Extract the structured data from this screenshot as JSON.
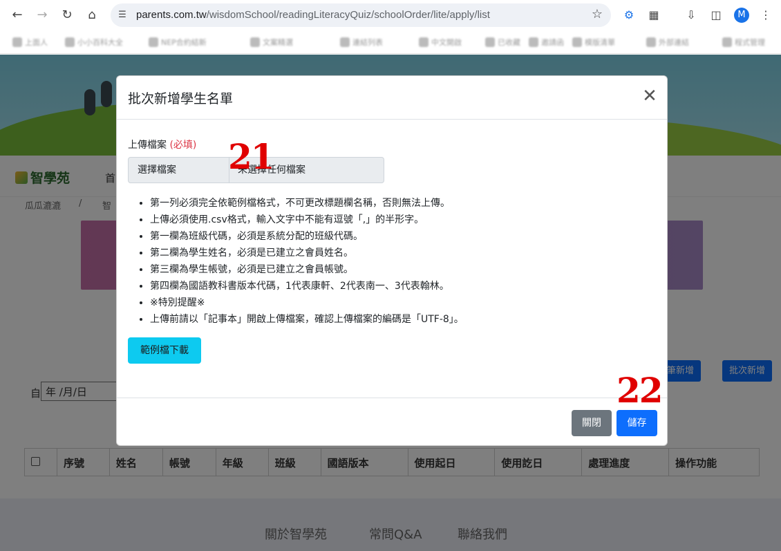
{
  "browser": {
    "url_host": "parents.com.tw",
    "url_path": "/wisdomSchool/readingLiteracyQuiz/schoolOrder/lite/apply/list",
    "profile_initial": "M",
    "bookmarks": [
      "上面人",
      "小小百科大全",
      "NEP合約結新",
      "文案精選",
      "連結列表",
      "中文開啟",
      "已收藏",
      "邀請函",
      "模版清單",
      "外部連結",
      "程式管理"
    ]
  },
  "site": {
    "logo": "智學苑",
    "menu_home": "首",
    "breadcrumb_1": "瓜瓜漉漉",
    "breadcrumb_sep": "/",
    "breadcrumb_2": "智",
    "date_label": "自",
    "date_placeholder": "年 /月/日",
    "btn_single_add": "單筆新增",
    "btn_single_add_visible": "筆新增",
    "btn_batch_add": "批次新增",
    "table_headers": [
      "序號",
      "姓名",
      "帳號",
      "年級",
      "班級",
      "國語版本",
      "使用起日",
      "使用訖日",
      "處理進度",
      "操作功能"
    ],
    "footer_links": [
      "關於智學苑",
      "常問Q&A",
      "聯絡我們"
    ]
  },
  "modal": {
    "title": "批次新增學生名單",
    "field_label": "上傳檔案",
    "required": "(必填)",
    "file_button": "選擇檔案",
    "file_status": "未選擇任何檔案",
    "rules": [
      "第一列必須完全依範例檔格式，不可更改標題欄名稱，否則無法上傳。",
      "上傳必須使用.csv格式，輸入文字中不能有逗號「,」的半形字。",
      "第一欄為班級代碼，必須是系統分配的班級代碼。",
      "第二欄為學生姓名，必須是已建立之會員姓名。",
      "第三欄為學生帳號，必須是已建立之會員帳號。",
      "第四欄為國語教科書版本代碼，1代表康軒、2代表南一、3代表翰林。",
      "※特別提醒※",
      "上傳前請以「記事本」開啟上傳檔案，確認上傳檔案的編碼是「UTF-8」。"
    ],
    "sample_button": "範例檔下載",
    "close_button": "關閉",
    "save_button": "儲存"
  },
  "annotations": {
    "step_21": "21",
    "step_22": "22"
  }
}
